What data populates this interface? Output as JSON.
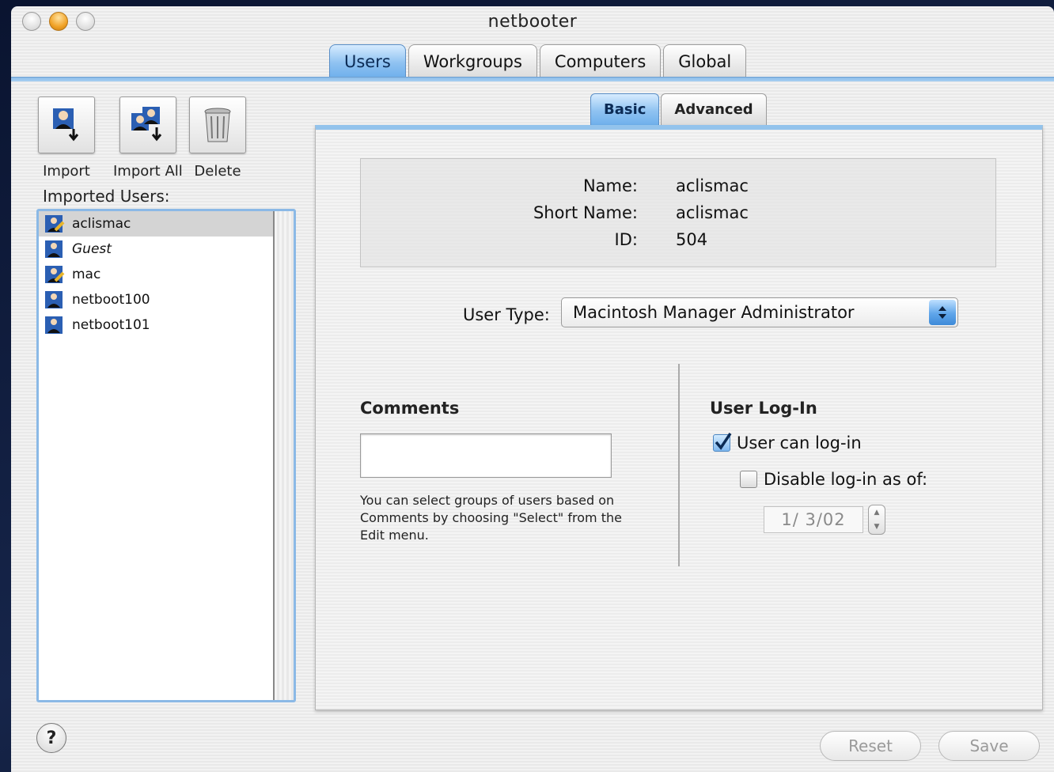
{
  "window": {
    "title": "netbooter"
  },
  "main_tabs": [
    {
      "label": "Users",
      "active": true
    },
    {
      "label": "Workgroups",
      "active": false
    },
    {
      "label": "Computers",
      "active": false
    },
    {
      "label": "Global",
      "active": false
    }
  ],
  "toolbar": {
    "import_label": "Import",
    "import_all_label": "Import All",
    "delete_label": "Delete"
  },
  "sidebar": {
    "heading": "Imported Users:",
    "users": [
      {
        "name": "aclismac",
        "icon": "admin-user-icon",
        "selected": true
      },
      {
        "name": "Guest",
        "icon": "user-icon",
        "selected": false
      },
      {
        "name": "mac",
        "icon": "admin-user-icon",
        "selected": false
      },
      {
        "name": "netboot100",
        "icon": "user-icon",
        "selected": false
      },
      {
        "name": "netboot101",
        "icon": "user-icon",
        "selected": false
      }
    ]
  },
  "sub_tabs": [
    {
      "label": "Basic",
      "active": true
    },
    {
      "label": "Advanced",
      "active": false
    }
  ],
  "details": {
    "name_label": "Name:",
    "name_value": "aclismac",
    "short_name_label": "Short Name:",
    "short_name_value": "aclismac",
    "id_label": "ID:",
    "id_value": "504"
  },
  "user_type": {
    "label": "User Type:",
    "selected": "Macintosh Manager Administrator"
  },
  "comments": {
    "title": "Comments",
    "value": "",
    "help": "You can select groups of users based on Comments by choosing \"Select\" from the Edit menu."
  },
  "login": {
    "title": "User Log-In",
    "can_login_label": "User can log-in",
    "can_login_checked": true,
    "disable_label": "Disable log-in as of:",
    "disable_checked": false,
    "date_value": "1/ 3/02"
  },
  "buttons": {
    "reset_label": "Reset",
    "save_label": "Save"
  },
  "colors": {
    "accent": "#6fb0ec",
    "selection": "#d4d4d4",
    "list_border": "#8bb9e6"
  }
}
